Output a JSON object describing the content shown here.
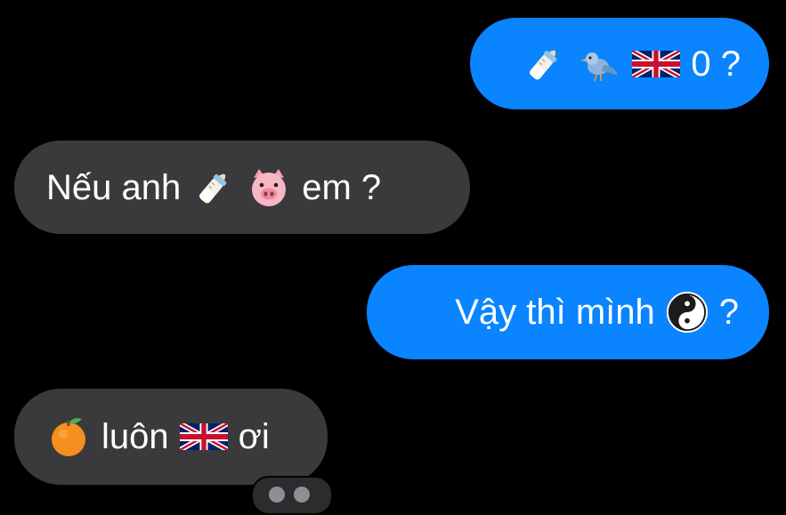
{
  "chat": {
    "messages": [
      {
        "id": "msg1",
        "direction": "sent",
        "parts": [
          "baby-bottle-emoji",
          "bird-emoji",
          "uk-flag-emoji",
          "0 ?"
        ]
      },
      {
        "id": "msg2",
        "direction": "received",
        "parts": [
          "Nếu anh",
          "baby-bottle-emoji",
          "pig-face-emoji",
          "em ?"
        ]
      },
      {
        "id": "msg3",
        "direction": "sent",
        "parts": [
          "Vậy thì mình",
          "yin-yang-emoji",
          "?"
        ]
      },
      {
        "id": "msg4",
        "direction": "received",
        "parts": [
          "tangerine-emoji",
          "luôn",
          "uk-flag-emoji",
          "ơi"
        ]
      }
    ],
    "texts": {
      "msg1_tail": "0 ?",
      "msg2_head": "Nếu anh",
      "msg2_tail": "em ?",
      "msg3_head": "Vậy thì mình",
      "msg3_tail": "?",
      "msg4_mid": "luôn",
      "msg4_tail": "ơi"
    },
    "colors": {
      "sent_bubble": "#0a84ff",
      "received_bubble": "#3a3a3c",
      "background": "#000000",
      "text": "#ffffff"
    }
  }
}
